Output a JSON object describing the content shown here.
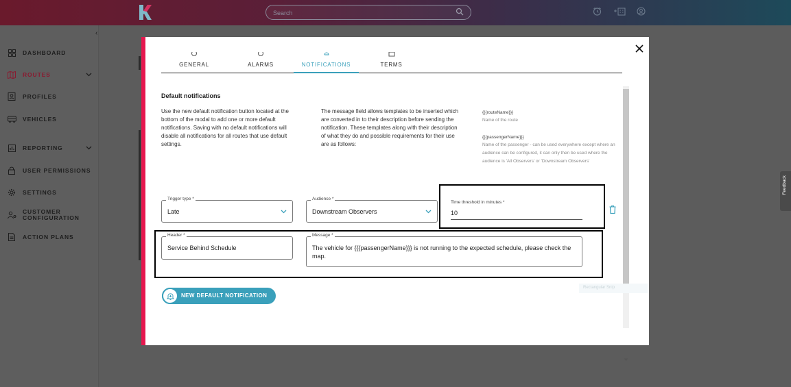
{
  "topbar": {
    "search_placeholder": "Search",
    "icons": [
      "alarm-clock-icon",
      "add-building-icon",
      "account-icon"
    ]
  },
  "sidebar": {
    "items": [
      {
        "label": "DASHBOARD",
        "icon": "dashboard-icon",
        "active": false
      },
      {
        "label": "ROUTES",
        "icon": "map-icon",
        "active": true,
        "expandable": true
      },
      {
        "label": "PROFILES",
        "icon": "profile-card-icon",
        "active": false
      },
      {
        "label": "VEHICLES",
        "icon": "bus-icon",
        "active": false
      },
      {
        "label": "REPORTING",
        "icon": "chart-icon",
        "active": false,
        "expandable": true
      },
      {
        "label": "USER PERMISSIONS",
        "icon": "lock-icon",
        "active": false
      },
      {
        "label": "SETTINGS",
        "icon": "gear-icon",
        "active": false
      },
      {
        "label": "CUSTOMER CONFIGURATION",
        "icon": "people-config-icon",
        "active": false
      },
      {
        "label": "ACTION PLANS",
        "icon": "document-icon",
        "active": false
      }
    ]
  },
  "modal": {
    "tabs": [
      {
        "label": "GENERAL",
        "active": false
      },
      {
        "label": "ALARMS",
        "active": false
      },
      {
        "label": "NOTIFICATIONS",
        "active": true
      },
      {
        "label": "TERMS",
        "active": false
      }
    ],
    "section_title": "Default notifications",
    "paragraph_left": "Use the new default notification button located at the bottom of the modal to add one or more default notifications. Saving with no default notifications will disable all notifications for all routes that use default settings.",
    "paragraph_middle": "The message field allows templates to be inserted which are converted in to their description before sending the notification. These templates along with their description of what they do and possible requirements for their use are as follows:",
    "templates": [
      {
        "name": "{{{routeName}}}",
        "description": "Name of the route"
      },
      {
        "name": "{{{passengerName}}}",
        "description": "Name of the passenger - can be used everywhere except where an audience can be configured, it can only then be used where the audience is 'All Observers' or 'Downstream Observers'"
      }
    ],
    "notification": {
      "trigger_type_label": "Trigger type *",
      "trigger_type_value": "Late",
      "audience_label": "Audience *",
      "audience_value": "Downstream Observers",
      "threshold_label": "Time threshold in minutes *",
      "threshold_value": "10",
      "header_label": "Header *",
      "header_value": "Service Behind Schedule",
      "message_label": "Message *",
      "message_value": "The vehicle for {{{passengerName}}} is not running to the expected schedule, please check the map."
    },
    "new_button_label": "NEW DEFAULT NOTIFICATION",
    "ghost_text": "Rectangular Snip"
  },
  "feedback_label": "Feedback",
  "colors": {
    "accent_pink": "#e6174e",
    "accent_teal": "#3aa0bb",
    "active_nav": "#8a1a30"
  }
}
